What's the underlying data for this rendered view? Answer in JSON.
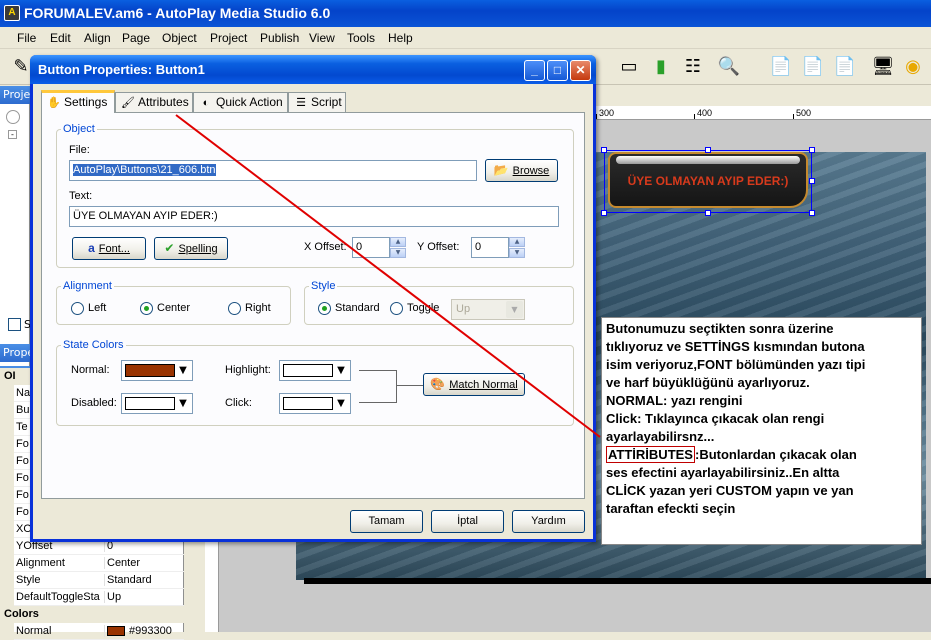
{
  "app": {
    "title": "FORUMALEV.am6 - AutoPlay Media Studio 6.0"
  },
  "menu": [
    "File",
    "Edit",
    "Align",
    "Page",
    "Object",
    "Project",
    "Publish",
    "View",
    "Tools",
    "Help"
  ],
  "panels": {
    "project_tab": "Proje",
    "properties_tab": "Prope",
    "checkbox_label": "S"
  },
  "properties": {
    "rows": [
      {
        "name": "OI",
        "value": "",
        "category": true
      },
      {
        "name": "Na",
        "value": ""
      },
      {
        "name": "Bu",
        "value": ""
      },
      {
        "name": "Te",
        "value": ""
      },
      {
        "name": "Fo",
        "value": ""
      },
      {
        "name": "Fo",
        "value": ""
      },
      {
        "name": "Fo",
        "value": ""
      },
      {
        "name": "Fo",
        "value": ""
      },
      {
        "name": "Fo",
        "value": ""
      },
      {
        "name": "XO",
        "value": ""
      },
      {
        "name": "YOffset",
        "value": "0"
      },
      {
        "name": "Alignment",
        "value": "Center"
      },
      {
        "name": "Style",
        "value": "Standard"
      },
      {
        "name": "DefaultToggleSta",
        "value": "Up"
      },
      {
        "name": "Colors",
        "value": "",
        "category": true
      },
      {
        "name": "Normal",
        "value": "#993300",
        "swatch": "#993300"
      }
    ]
  },
  "ruler": {
    "ticks": [
      "300",
      "400",
      "500"
    ]
  },
  "canvas_button": {
    "label": "ÜYE OLMAYAN AYIP EDER:)"
  },
  "note": {
    "lines_before": [
      "Butonumuzu seçtikten sonra üzerine",
      "tıklıyoruz ve SETTİNGS kısmından butona",
      "isim veriyoruz,FONT bölümünden yazı tipi",
      "ve harf büyüklüğünü ayarlıyoruz.",
      "NORMAL: yazı rengini",
      "Click: Tıklayınca çıkacak olan rengi",
      "ayarlayabilirsnz..."
    ],
    "highlight": "ATTİRİBUTES",
    "highlight_rest": ":Butonlardan çıkacak olan",
    "lines_after": [
      "ses efectini ayarlayabilirsiniz..En altta",
      "CLİCK yazan yeri CUSTOM yapın ve yan",
      "taraftan efeckti seçin"
    ]
  },
  "dialog": {
    "title": "Button Properties: Button1",
    "tabs": [
      "Settings",
      "Attributes",
      "Quick Action",
      "Script"
    ],
    "object": {
      "legend": "Object",
      "file_label": "File:",
      "file_value": "AutoPlay\\Buttons\\21_606.btn",
      "browse": "Browse",
      "text_label": "Text:",
      "text_value": "ÜYE OLMAYAN AYIP EDER:)",
      "font_button": "Font...",
      "spelling_button": "Spelling",
      "x_offset_label": "X Offset:",
      "x_offset_value": "0",
      "y_offset_label": "Y Offset:",
      "y_offset_value": "0"
    },
    "alignment": {
      "legend": "Alignment",
      "options": [
        "Left",
        "Center",
        "Right"
      ],
      "selected": "Center"
    },
    "style": {
      "legend": "Style",
      "options": [
        "Standard",
        "Toggle"
      ],
      "selected": "Standard",
      "toggle_state": "Up"
    },
    "state_colors": {
      "legend": "State Colors",
      "normal_label": "Normal:",
      "normal_color": "#993300",
      "disabled_label": "Disabled:",
      "disabled_color": "#ffffff",
      "highlight_label": "Highlight:",
      "highlight_color": "#ffffff",
      "click_label": "Click:",
      "click_color": "#ffffff",
      "match_normal": "Match Normal"
    },
    "buttons": {
      "ok": "Tamam",
      "cancel": "İptal",
      "help": "Yardım"
    }
  }
}
